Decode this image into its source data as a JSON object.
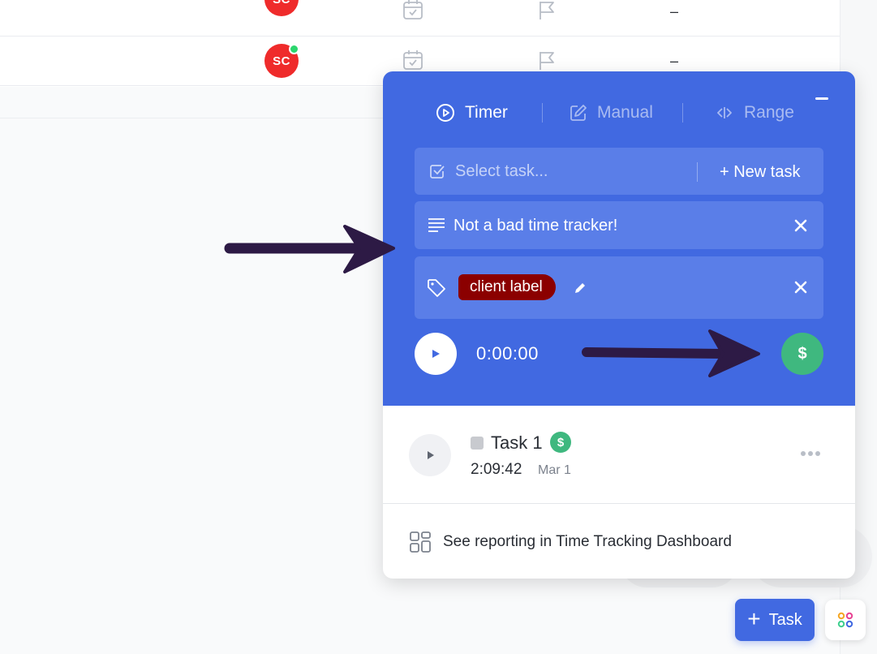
{
  "list": {
    "rows": [
      {
        "assignee_initials": "SC",
        "priority_value": "–"
      },
      {
        "assignee_initials": "SC",
        "priority_value": "–"
      }
    ]
  },
  "timer_popup": {
    "tabs": [
      {
        "label": "Timer",
        "icon": "play-circle-icon",
        "active": true
      },
      {
        "label": "Manual",
        "icon": "pencil-square-icon",
        "active": false
      },
      {
        "label": "Range",
        "icon": "range-arrows-icon",
        "active": false
      }
    ],
    "task_select": {
      "placeholder": "Select task...",
      "new_task_label": "+ New task"
    },
    "description": {
      "value": "Not a bad time tracker!"
    },
    "tags": {
      "items": [
        {
          "label": "client label",
          "color": "#8b0000"
        }
      ]
    },
    "timer": {
      "readout": "0:00:00",
      "billable_symbol": "$"
    },
    "entries": [
      {
        "name": "Task 1",
        "billable_symbol": "$",
        "duration": "2:09:42",
        "date": "Mar 1"
      }
    ],
    "report_link": {
      "label": "See reporting in Time Tracking Dashboard"
    }
  },
  "footer": {
    "add_task_label": "Task"
  },
  "colors": {
    "accent": "#4169e1",
    "billable": "#3fb87f",
    "avatar": "#ef2b2b",
    "tag": "#8b0000",
    "annotation_arrow": "#2d1a45"
  }
}
